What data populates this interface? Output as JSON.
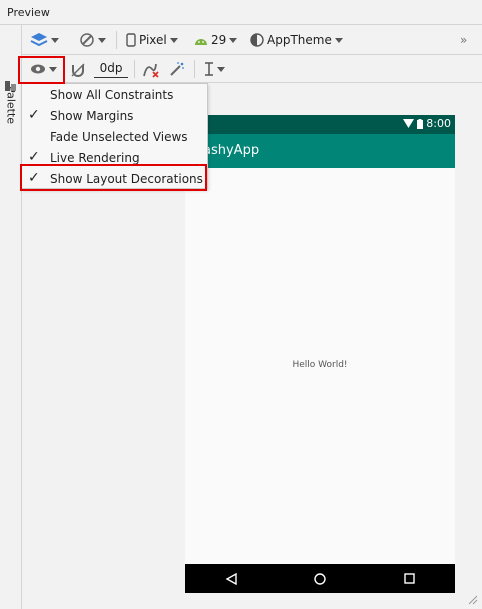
{
  "header": {
    "title": "Preview"
  },
  "palette": {
    "label": "Palette"
  },
  "toolbar1": {
    "device": "Pixel",
    "api_level": "29",
    "theme": "AppTheme",
    "overflow": "»"
  },
  "toolbar2": {
    "margin_value": "0dp"
  },
  "view_options_menu": {
    "items": [
      {
        "label": "Show All Constraints",
        "checked": false
      },
      {
        "label": "Show Margins",
        "checked": true
      },
      {
        "label": "Fade Unselected Views",
        "checked": false
      },
      {
        "label": "Live Rendering",
        "checked": true
      },
      {
        "label": "Show Layout Decorations",
        "checked": true
      }
    ],
    "check_glyph": "✓"
  },
  "phone": {
    "status_time": "8:00",
    "app_title": "ashyApp",
    "hello_text": "Hello World!",
    "colors": {
      "status_bar": "#00574b",
      "app_bar": "#008577",
      "nav_bar": "#000000",
      "background": "#fafafa"
    }
  },
  "highlight_color": "#e00000"
}
